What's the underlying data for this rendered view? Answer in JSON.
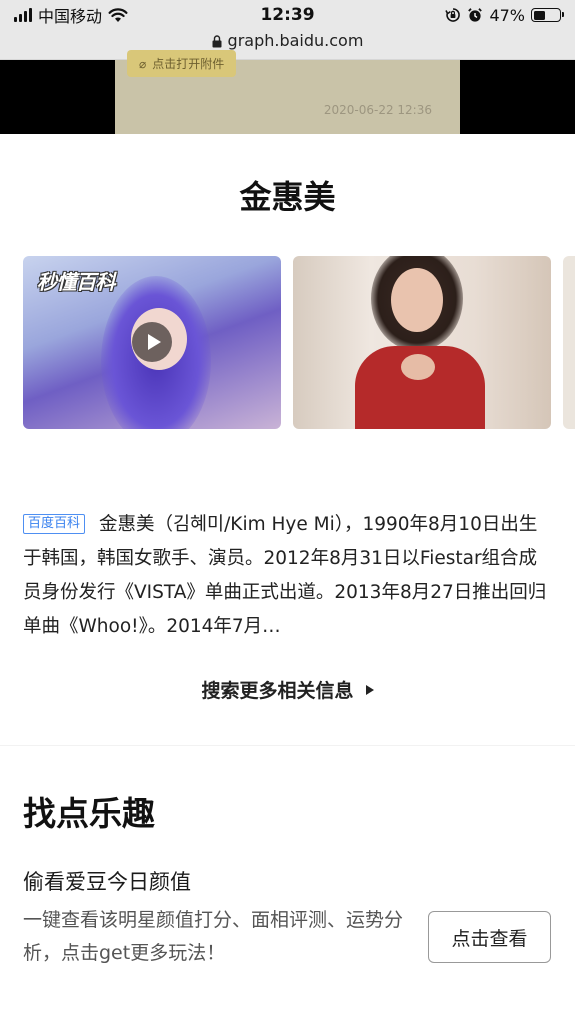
{
  "status_bar": {
    "carrier": "中国移动",
    "time": "12:39",
    "battery_percent": "47%",
    "battery_level": 0.47,
    "url": "graph.baidu.com",
    "icons": [
      "signal-icon",
      "wifi-icon",
      "lock-icon",
      "orientation-lock-icon",
      "alarm-icon",
      "battery-icon"
    ]
  },
  "attachment": {
    "label": "点击打开附件",
    "date": "2020-06-22 12:36"
  },
  "entity": {
    "title": "金惠美"
  },
  "media": {
    "video_badge": "秒懂百科",
    "icons": [
      "play-icon"
    ]
  },
  "summary": {
    "tag": "百度百科",
    "text": "金惠美（김혜미/Kim Hye Mi），1990年8月10日出生于韩国，韩国女歌手、演员。2012年8月31日以Fiestar组合成员身份发行《VISTA》单曲正式出道。2013年8月27日推出回归单曲《Whoo!》。2014年7月…"
  },
  "search_more": {
    "label": "搜索更多相关信息"
  },
  "fun_section": {
    "title": "找点乐趣",
    "subtitle": "偷看爱豆今日颜值",
    "description": "一键查看该明星颜值打分、面相评测、运势分析，点击get更多玩法！",
    "button_label": "点击查看"
  },
  "colors": {
    "tag_blue": "#3a82ef",
    "status_bar_bg": "#e8e8e8",
    "attach_pill": "#d9c779"
  }
}
